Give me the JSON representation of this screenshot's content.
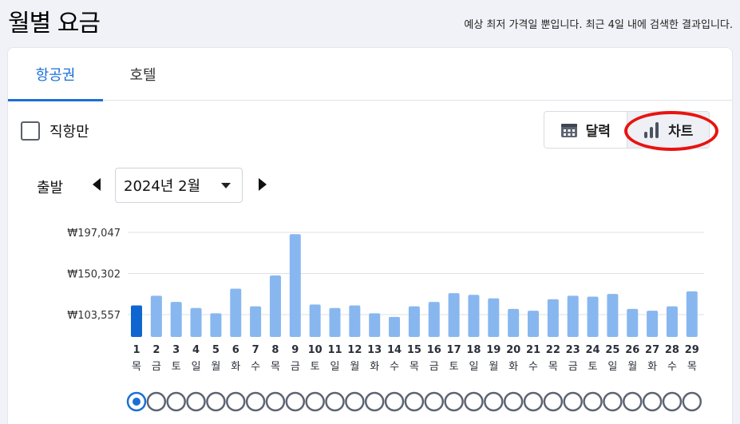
{
  "page": {
    "title": "월별 요금",
    "note": "예상 최저 가격일 뿐입니다. 최근 4일 내에 검색한 결과입니다."
  },
  "tabs": [
    {
      "label": "항공권",
      "active": true
    },
    {
      "label": "호텔",
      "active": false
    }
  ],
  "filters": {
    "direct_only_label": "직항만",
    "direct_only_checked": false
  },
  "view_toggle": {
    "calendar_label": "달력",
    "chart_label": "차트",
    "selected": "chart"
  },
  "depart": {
    "label": "출발",
    "month_value": "2024년 2월"
  },
  "colors": {
    "accent": "#1a6fd6",
    "bar": "#88b7f0",
    "bar_selected": "#0f66d0",
    "highlight": "#e8130f",
    "radio_border": "#5d6472"
  },
  "chart_data": {
    "type": "bar",
    "y_ticks": [
      "₩197,047",
      "₩150,302",
      "₩103,557"
    ],
    "y_tick_values": [
      197047,
      150302,
      103557
    ],
    "categories": [
      "1",
      "2",
      "3",
      "4",
      "5",
      "6",
      "7",
      "8",
      "9",
      "10",
      "11",
      "12",
      "13",
      "14",
      "15",
      "16",
      "17",
      "18",
      "19",
      "20",
      "21",
      "22",
      "23",
      "24",
      "25",
      "26",
      "27",
      "28",
      "29"
    ],
    "weekdays": [
      "목",
      "금",
      "토",
      "일",
      "월",
      "화",
      "수",
      "목",
      "금",
      "토",
      "일",
      "월",
      "화",
      "수",
      "목",
      "금",
      "토",
      "일",
      "월",
      "화",
      "수",
      "목",
      "금",
      "토",
      "일",
      "월",
      "화",
      "수",
      "목"
    ],
    "values": [
      114000,
      125000,
      118000,
      111000,
      105000,
      133000,
      113000,
      148000,
      195000,
      115000,
      111000,
      114000,
      105000,
      101000,
      113000,
      118000,
      128000,
      126000,
      122000,
      110000,
      108000,
      121000,
      125000,
      124000,
      127000,
      110000,
      108000,
      113000,
      130000
    ],
    "selected_index": 0,
    "grid": true
  }
}
